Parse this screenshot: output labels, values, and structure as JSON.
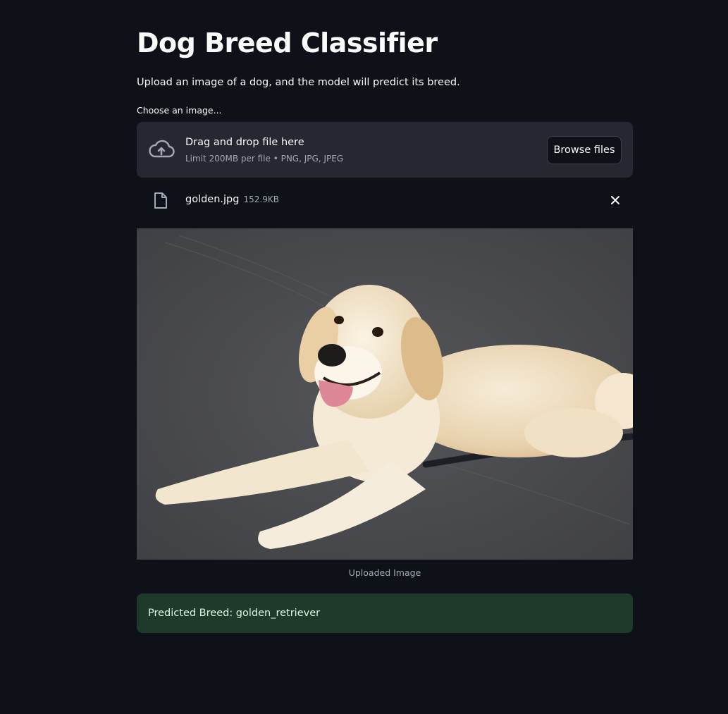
{
  "page": {
    "title": "Dog Breed Classifier",
    "subtitle": "Upload an image of a dog, and the model will predict its breed."
  },
  "uploader": {
    "label": "Choose an image...",
    "drop_text": "Drag and drop file here",
    "limit_text": "Limit 200MB per file • PNG, JPG, JPEG",
    "browse_label": "Browse files",
    "icon": "cloud-upload-icon"
  },
  "file": {
    "name": "golden.jpg",
    "size": "152.9KB",
    "icon": "file-icon"
  },
  "image": {
    "caption": "Uploaded Image"
  },
  "result": {
    "text": "Predicted Breed: golden_retriever"
  },
  "colors": {
    "background": "#0e1117",
    "dropzone": "#262730",
    "success_bg": "#1e3a2a",
    "muted_text": "#a3a8b8"
  }
}
